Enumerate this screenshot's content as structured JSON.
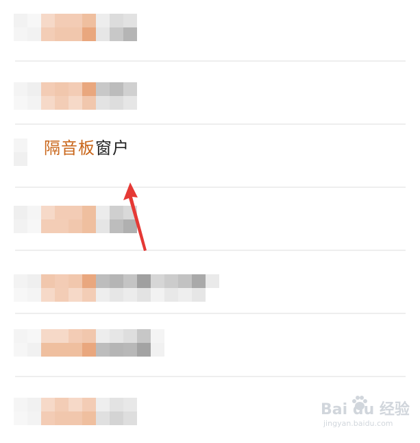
{
  "list": {
    "highlighted_item": {
      "keyword": "隔音板",
      "rest": "窗户"
    }
  },
  "watermark": {
    "brand": "Bai du 经验",
    "url": "jingyan.baidu.com"
  },
  "colors": {
    "keyword": "#c9661a",
    "arrow": "#e53935",
    "divider": "#eeeeee",
    "blur_orange_light": "#f6d9c8",
    "blur_orange_mid": "#efbf9f",
    "blur_orange_dark": "#e9a77e",
    "blur_gray_light": "#e6e6e6",
    "blur_gray_mid": "#c8c8c8",
    "blur_gray_dark": "#a9a9a9"
  }
}
